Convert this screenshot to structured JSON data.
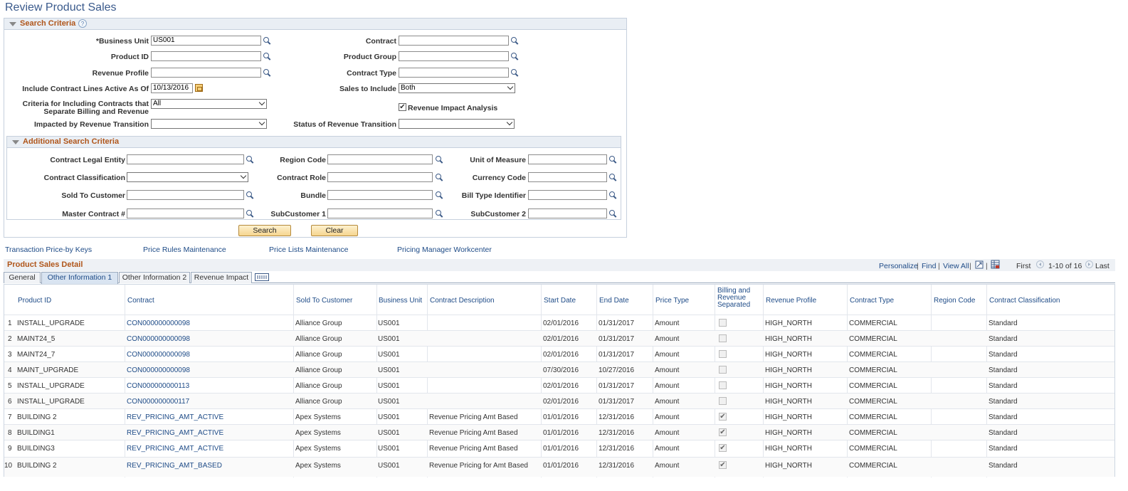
{
  "page": {
    "title": "Review Product Sales"
  },
  "search": {
    "section_title": "Search Criteria",
    "help": "?",
    "business_unit": {
      "label": "*Business Unit",
      "value": "US001"
    },
    "contract": {
      "label": "Contract",
      "value": ""
    },
    "product_id": {
      "label": "Product ID",
      "value": ""
    },
    "product_group": {
      "label": "Product Group",
      "value": ""
    },
    "revenue_profile": {
      "label": "Revenue Profile",
      "value": ""
    },
    "contract_type": {
      "label": "Contract Type",
      "value": ""
    },
    "active_as_of": {
      "label": "Include Contract Lines Active As Of",
      "value": "10/13/2016"
    },
    "sales_to_include": {
      "label": "Sales to Include",
      "value": "Both"
    },
    "criteria_sep": {
      "label_line1": "Criteria for Including Contracts that",
      "label_line2": "Separate Billing and Revenue",
      "value": "All"
    },
    "revenue_impact": {
      "label": "Revenue Impact Analysis",
      "checked": "✔"
    },
    "impacted_by": {
      "label": "Impacted by Revenue Transition",
      "value": ""
    },
    "status_transition": {
      "label": "Status of Revenue Transition",
      "value": ""
    }
  },
  "additional": {
    "section_title": "Additional Search Criteria",
    "contract_legal_entity": "Contract Legal Entity",
    "region_code": "Region Code",
    "unit_of_measure": "Unit of Measure",
    "contract_classification": "Contract Classification",
    "contract_role": "Contract Role",
    "currency_code": "Currency Code",
    "sold_to_customer": "Sold To Customer",
    "bundle": "Bundle",
    "bill_type_identifier": "Bill Type Identifier",
    "master_contract": "Master Contract #",
    "subcustomer1": "SubCustomer 1",
    "subcustomer2": "SubCustomer 2"
  },
  "buttons": {
    "search": "Search",
    "clear": "Clear"
  },
  "links": {
    "tpbk": "Transaction Price-by Keys",
    "prm": "Price Rules Maintenance",
    "plm": "Price Lists Maintenance",
    "pmw": "Pricing Manager Workcenter"
  },
  "grid": {
    "title": "Product Sales Detail",
    "toolbar": {
      "personalize": "Personalize",
      "find": "Find",
      "view_all": "View All",
      "first": "First",
      "range": "1-10 of 16",
      "last": "Last",
      "sep": "|"
    },
    "tabs": [
      "General",
      "Other Information 1",
      "Other Information 2",
      "Revenue Impact"
    ],
    "columns": {
      "product_id": "Product ID",
      "contract": "Contract",
      "sold_to": "Sold To Customer",
      "bu": "Business Unit",
      "desc": "Contract Description",
      "start": "Start Date",
      "end": "End Date",
      "price_type": "Price Type",
      "billing_sep_1": "Billing and",
      "billing_sep_2": "Revenue",
      "billing_sep_3": "Separated",
      "rev_profile": "Revenue Profile",
      "contract_type": "Contract Type",
      "region": "Region Code",
      "classification": "Contract Classification"
    },
    "rows": [
      {
        "n": "1",
        "pid": "INSTALL_UPGRADE",
        "contract": "CON000000000098",
        "sold": "Alliance Group",
        "bu": "US001",
        "desc": "",
        "start": "02/01/2016",
        "end": "01/31/2017",
        "ptype": "Amount",
        "sep": "",
        "rp": "HIGH_NORTH",
        "ct": "COMMERCIAL",
        "rc": "",
        "cc": "Standard"
      },
      {
        "n": "2",
        "pid": "MAINT24_5",
        "contract": "CON000000000098",
        "sold": "Alliance Group",
        "bu": "US001",
        "desc": "",
        "start": "02/01/2016",
        "end": "01/31/2017",
        "ptype": "Amount",
        "sep": "",
        "rp": "HIGH_NORTH",
        "ct": "COMMERCIAL",
        "rc": "",
        "cc": "Standard"
      },
      {
        "n": "3",
        "pid": "MAINT24_7",
        "contract": "CON000000000098",
        "sold": "Alliance Group",
        "bu": "US001",
        "desc": "",
        "start": "02/01/2016",
        "end": "01/31/2017",
        "ptype": "Amount",
        "sep": "",
        "rp": "HIGH_NORTH",
        "ct": "COMMERCIAL",
        "rc": "",
        "cc": "Standard"
      },
      {
        "n": "4",
        "pid": "MAINT_UPGRADE",
        "contract": "CON000000000098",
        "sold": "Alliance Group",
        "bu": "US001",
        "desc": "",
        "start": "07/30/2016",
        "end": "10/27/2016",
        "ptype": "Amount",
        "sep": "",
        "rp": "HIGH_NORTH",
        "ct": "COMMERCIAL",
        "rc": "",
        "cc": "Standard"
      },
      {
        "n": "5",
        "pid": "INSTALL_UPGRADE",
        "contract": "CON000000000113",
        "sold": "Alliance Group",
        "bu": "US001",
        "desc": "",
        "start": "02/01/2016",
        "end": "01/31/2017",
        "ptype": "Amount",
        "sep": "",
        "rp": "HIGH_NORTH",
        "ct": "COMMERCIAL",
        "rc": "",
        "cc": "Standard"
      },
      {
        "n": "6",
        "pid": "INSTALL_UPGRADE",
        "contract": "CON000000000117",
        "sold": "Alliance Group",
        "bu": "US001",
        "desc": "",
        "start": "02/01/2016",
        "end": "01/31/2017",
        "ptype": "Amount",
        "sep": "",
        "rp": "HIGH_NORTH",
        "ct": "COMMERCIAL",
        "rc": "",
        "cc": "Standard"
      },
      {
        "n": "7",
        "pid": "BUILDING 2",
        "contract": "REV_PRICING_AMT_ACTIVE",
        "sold": "Apex Systems",
        "bu": "US001",
        "desc": "Revenue Pricing Amt Based",
        "start": "01/01/2016",
        "end": "12/31/2016",
        "ptype": "Amount",
        "sep": "✔",
        "rp": "HIGH_NORTH",
        "ct": "COMMERCIAL",
        "rc": "",
        "cc": "Standard"
      },
      {
        "n": "8",
        "pid": "BUILDING1",
        "contract": "REV_PRICING_AMT_ACTIVE",
        "sold": "Apex Systems",
        "bu": "US001",
        "desc": "Revenue Pricing Amt Based",
        "start": "01/01/2016",
        "end": "12/31/2016",
        "ptype": "Amount",
        "sep": "✔",
        "rp": "HIGH_NORTH",
        "ct": "COMMERCIAL",
        "rc": "",
        "cc": "Standard"
      },
      {
        "n": "9",
        "pid": "BUILDING3",
        "contract": "REV_PRICING_AMT_ACTIVE",
        "sold": "Apex Systems",
        "bu": "US001",
        "desc": "Revenue Pricing Amt Based",
        "start": "01/01/2016",
        "end": "12/31/2016",
        "ptype": "Amount",
        "sep": "✔",
        "rp": "HIGH_NORTH",
        "ct": "COMMERCIAL",
        "rc": "",
        "cc": "Standard"
      },
      {
        "n": "10",
        "pid": "BUILDING 2",
        "contract": "REV_PRICING_AMT_BASED",
        "sold": "Apex Systems",
        "bu": "US001",
        "desc": "Revenue Pricing for Amt Based",
        "start": "01/01/2016",
        "end": "12/31/2016",
        "ptype": "Amount",
        "sep": "✔",
        "rp": "HIGH_NORTH",
        "ct": "COMMERCIAL",
        "rc": "",
        "cc": "Standard"
      }
    ]
  }
}
